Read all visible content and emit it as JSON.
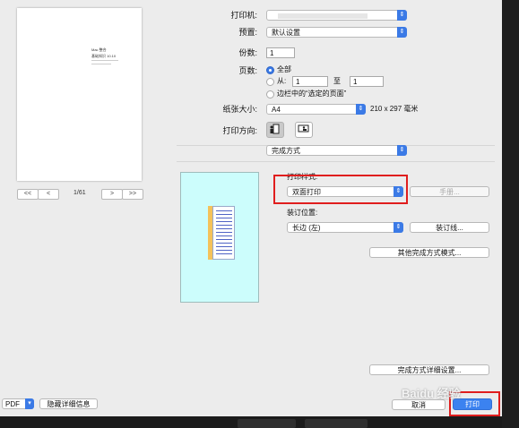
{
  "printer": {
    "label": "打印机:",
    "value": ""
  },
  "preset": {
    "label": "预置:",
    "value": "默认设置"
  },
  "copies": {
    "label": "份数:",
    "value": "1"
  },
  "pages": {
    "label": "页数:",
    "all_label": "全部",
    "from_label": "从:",
    "from_value": "1",
    "to_label": "至",
    "to_value": "1",
    "selection_label": "边栏中的“选定的页面”"
  },
  "paper_size": {
    "label": "纸张大小:",
    "value": "A4",
    "dims": "210 x 297 毫米"
  },
  "orientation": {
    "label": "打印方向:"
  },
  "section": {
    "value": "完成方式"
  },
  "print_style": {
    "label": "打印样式:",
    "value": "双面打印",
    "manual_button": "手册..."
  },
  "binding": {
    "label": "装订位置:",
    "value": "长边 (左)",
    "binding_button": "装订线..."
  },
  "other_finishing_button": "其他完成方式模式...",
  "finishing_detail_button": "完成方式详细设置...",
  "preview": {
    "apple_logo": "",
    "doc_title_line1": "Mac 整合",
    "doc_title_line2": "基础知识 10.10",
    "page_indicator": "1/61",
    "first": "<<",
    "prev": "<",
    "next": ">",
    "last": ">>"
  },
  "bottom": {
    "pdf": "PDF",
    "hide_details": "隐藏详细信息",
    "cancel": "取消",
    "print": "打印"
  },
  "watermark": "Baidu 经验",
  "colors": {
    "accent": "#3b7ae6",
    "highlight": "#e01e1e",
    "booklet_bg": "#ccfdfc"
  }
}
